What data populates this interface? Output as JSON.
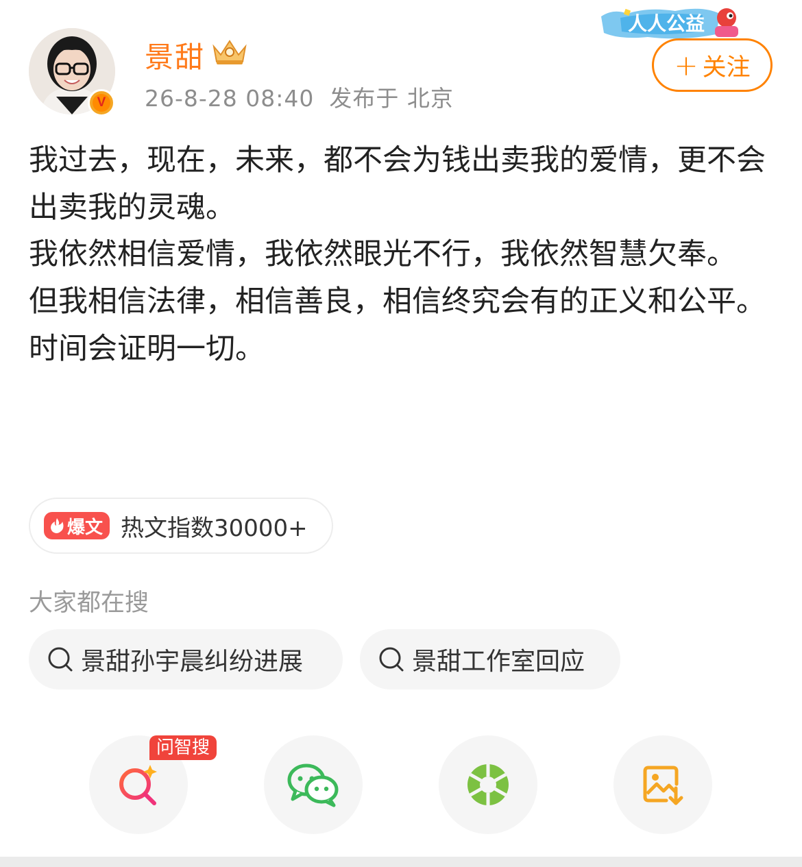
{
  "author": {
    "name": "景甜",
    "time": "26-8-28 08:40",
    "location": "发布于 北京"
  },
  "charity_badge": "人人公益",
  "follow_button": "关注",
  "post": {
    "paragraphs": [
      "我过去，现在，未来，都不会为钱出卖我的爱情，更不会出卖我的灵魂。",
      "我依然相信爱情，我依然眼光不行，我依然智慧欠奉。",
      "但我相信法律，相信善良，相信终究会有的正义和公平。",
      "时间会证明一切。"
    ]
  },
  "hot": {
    "tag": "爆文",
    "label": "热文指数30000+"
  },
  "search": {
    "heading": "大家都在搜",
    "chips": [
      "景甜孙宇晨纠纷进展",
      "景甜工作室回应"
    ]
  },
  "share": {
    "ai_tag": "问智搜",
    "icons": [
      "ai-search-icon",
      "wechat-icon",
      "moments-icon",
      "save-image-icon"
    ]
  },
  "colors": {
    "accent": "#ff8200",
    "username": "#ff7a1a",
    "hot_tag": "#f8514d",
    "wechat": "#3cb95a",
    "save": "#f5a623"
  }
}
